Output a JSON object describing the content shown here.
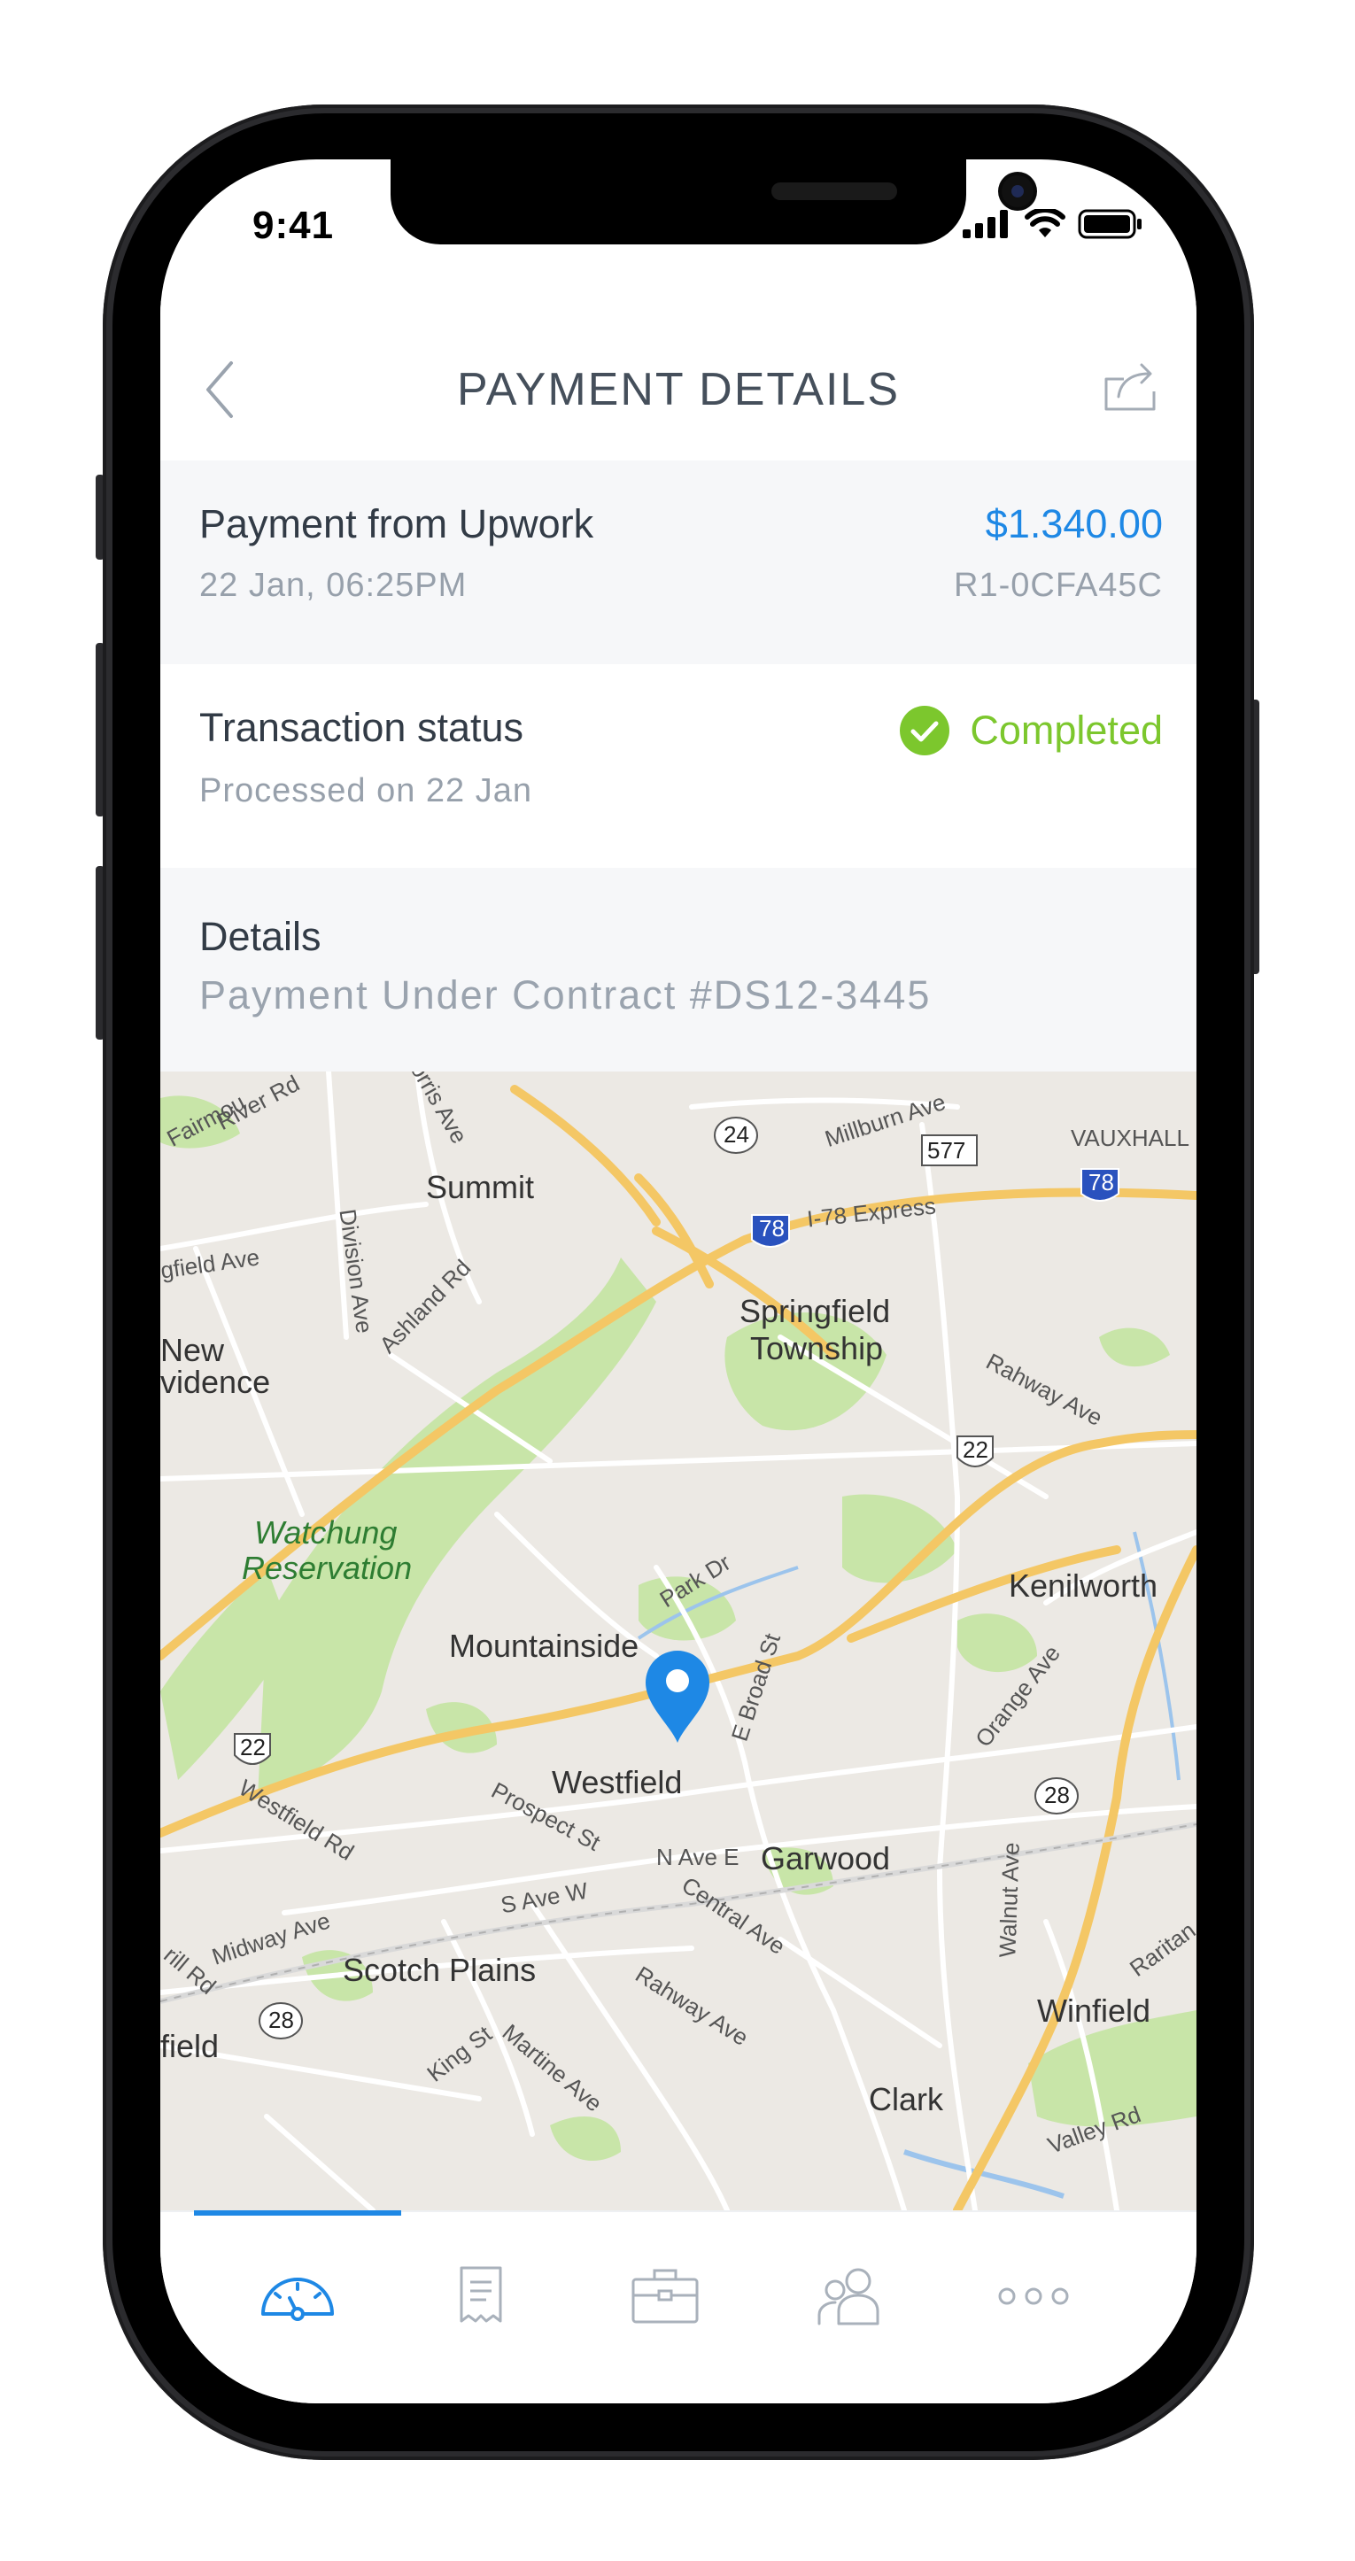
{
  "status_bar": {
    "time": "9:41"
  },
  "header": {
    "title": "PAYMENT DETAILS"
  },
  "payment": {
    "label": "Payment from Upwork",
    "date": "22 Jan, 06:25PM",
    "amount": "$1.340.00",
    "reference": "R1-0CFA45C"
  },
  "transaction": {
    "label": "Transaction status",
    "processed": "Processed on 22 Jan",
    "status": "Completed"
  },
  "details": {
    "label": "Details",
    "value": "Payment Under Contract #DS12-3445"
  },
  "map": {
    "places": {
      "summit": "Summit",
      "springfield": "Springfield",
      "township": "Township",
      "new": "New",
      "vidence": "vidence",
      "watchung": "Watchung",
      "reservation": "Reservation",
      "kenilworth": "Kenilworth",
      "mountainside": "Mountainside",
      "westfield": "Westfield",
      "garwood": "Garwood",
      "scotch_plains": "Scotch Plains",
      "winfield": "Winfield",
      "clark": "Clark",
      "field": "field",
      "vauxhall": "VAUXHALL"
    },
    "roads": {
      "i78_express": "I-78 Express",
      "millburn": "Millburn Ave",
      "rahway_ave": "Rahway Ave",
      "park_dr": "Park Dr",
      "e_broad": "E Broad St",
      "orange_ave": "Orange Ave",
      "prospect": "Prospect St",
      "n_ave_e": "N Ave E",
      "s_ave_w": "S Ave W",
      "central": "Central Ave",
      "midway": "Midway Ave",
      "westfield_rd": "Westfield Rd",
      "walnut": "Walnut Ave",
      "division": "Division Ave",
      "ashland": "Ashland Rd",
      "gfield": "gfield Ave",
      "king": "King St",
      "martine": "Martine Ave",
      "valley": "Valley Rd",
      "raritan": "Raritan",
      "rahway2": "Rahway Ave",
      "fairmount": "Fairmou",
      "river": "River Rd",
      "morris": "orris Ave",
      "rill": "rill Rd"
    },
    "shields": {
      "r24": "24",
      "r577": "577",
      "i78a": "78",
      "i78b": "78",
      "us22a": "22",
      "us22b": "22",
      "r28a": "28",
      "r28b": "28"
    }
  },
  "tabbar": {
    "items": [
      "dashboard",
      "receipts",
      "briefcase",
      "contacts",
      "more"
    ]
  },
  "colors": {
    "accent": "#1e88e5",
    "success": "#7cc72d",
    "text": "#323b46",
    "muted": "#97a0ab"
  }
}
